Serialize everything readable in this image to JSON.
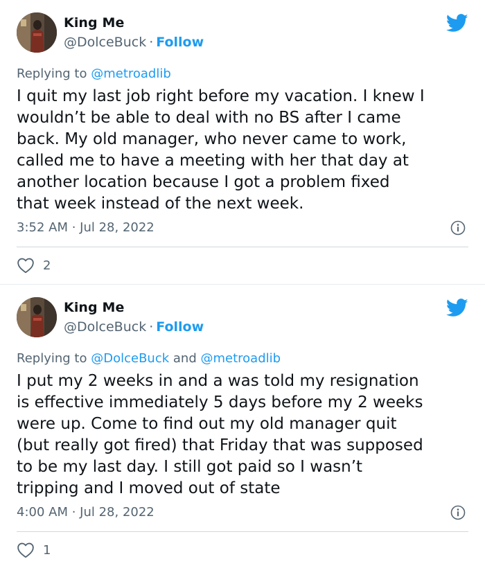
{
  "tweets": [
    {
      "author": {
        "name": "King Me",
        "handle": "@DolceBuck",
        "follow_label": "Follow"
      },
      "replying": {
        "prefix": "Replying to",
        "mentions": [
          "@metroadlib"
        ],
        "joiner": ""
      },
      "text_lines": [
        "I quit my last job right before my vacation. I knew I",
        "wouldn’t be able to deal with no BS after I came",
        "back. My old manager, who never came to work,",
        "called me to have a meeting with her that day at",
        "another location because I got a problem fixed",
        "that week instead of the next week."
      ],
      "timestamp": "3:52 AM · Jul 28, 2022",
      "likes": "2",
      "icons": {
        "brand": "twitter-bird-icon",
        "info": "info-icon",
        "like": "heart-icon"
      }
    },
    {
      "author": {
        "name": "King Me",
        "handle": "@DolceBuck",
        "follow_label": "Follow"
      },
      "replying": {
        "prefix": "Replying to",
        "mentions": [
          "@DolceBuck",
          "@metroadlib"
        ],
        "joiner": "and"
      },
      "text_lines": [
        "I put my 2 weeks in and a was told my resignation",
        "is effective immediately 5 days before my 2 weeks",
        "were up. Come to find out my old manager quit",
        "(but really got fired) that Friday that was supposed",
        "to be my last day. I still got paid so I wasn’t",
        "tripping and I moved out of state"
      ],
      "timestamp": "4:00 AM · Jul 28, 2022",
      "likes": "1",
      "icons": {
        "brand": "twitter-bird-icon",
        "info": "info-icon",
        "like": "heart-icon"
      }
    }
  ],
  "colors": {
    "accent": "#1d9bf0",
    "secondary_text": "#536471",
    "primary_text": "#0f1419",
    "divider": "#cfd9de"
  },
  "separator": "·"
}
